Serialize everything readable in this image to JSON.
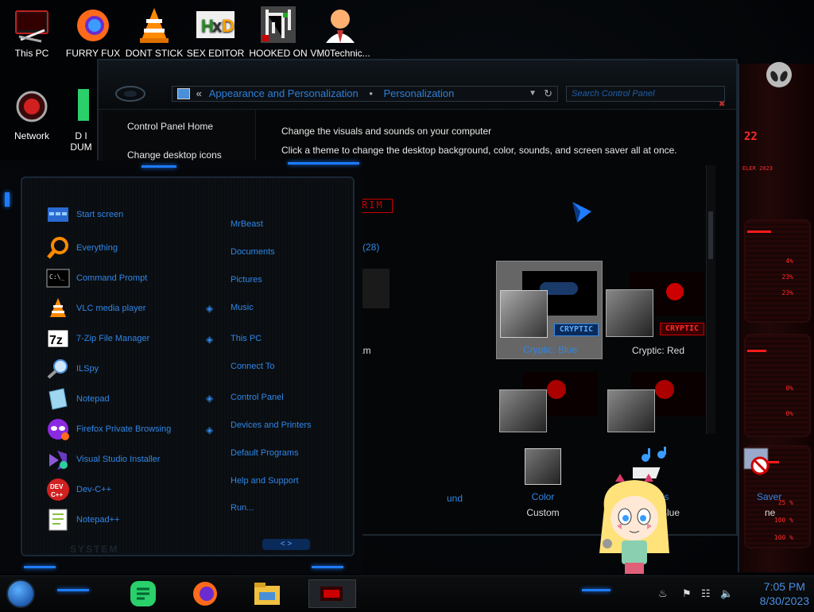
{
  "desktop": {
    "icons": [
      {
        "label": "This PC"
      },
      {
        "label": "FURRY FUX"
      },
      {
        "label": "DONT STICK"
      },
      {
        "label": "SEX EDITOR"
      },
      {
        "label": "HOOKED ON"
      },
      {
        "label": "VM0Technic..."
      },
      {
        "label": "Network"
      },
      {
        "label": "D I DUM"
      }
    ]
  },
  "control_panel": {
    "breadcrumb": {
      "sep": "«",
      "part1": "Appearance and Personalization",
      "dot": "•",
      "part2": "Personalization"
    },
    "search_placeholder": "Search Control Panel",
    "sidebar": {
      "home": "Control Panel Home",
      "desktop_icons": "Change desktop icons"
    },
    "main": {
      "heading": "Change the visuals and sounds on your computer",
      "subheading": "Click a theme to change the desktop background, color, sounds, and screen saver all at once.",
      "count": "(28)",
      "partial_label": "am",
      "themes": [
        {
          "label": "Cryptic: Blue",
          "selected": true,
          "badge": "CRYPTIC"
        },
        {
          "label": "Cryptic: Red",
          "selected": false,
          "badge": "CRYPTIC"
        }
      ],
      "bottom": {
        "background_suffix": "und",
        "color_title": "Color",
        "color_value": "Custom",
        "sounds_title": "Sounds",
        "sounds_value": "Cryptic: Blue",
        "saver_title": "Saver",
        "saver_value": "ne"
      }
    },
    "logo_text": "RIM"
  },
  "start_menu": {
    "apps": [
      {
        "label": "Start screen"
      },
      {
        "label": "Everything"
      },
      {
        "label": "Command Prompt"
      },
      {
        "label": "VLC media player"
      },
      {
        "label": "7-Zip File Manager"
      },
      {
        "label": "ILSpy"
      },
      {
        "label": "Notepad"
      },
      {
        "label": "Firefox Private Browsing"
      },
      {
        "label": "Visual Studio Installer"
      },
      {
        "label": "Dev-C++"
      },
      {
        "label": "Notepad++"
      }
    ],
    "links": [
      {
        "label": "MrBeast"
      },
      {
        "label": "Documents"
      },
      {
        "label": "Pictures"
      },
      {
        "label": "Music"
      },
      {
        "label": "This PC"
      },
      {
        "label": "Connect To"
      },
      {
        "label": "Control Panel"
      },
      {
        "label": "Devices and Printers"
      },
      {
        "label": "Default Programs"
      },
      {
        "label": "Help and Support"
      },
      {
        "label": "Run..."
      }
    ],
    "footer_text": "SYSTEM",
    "nav_arrows": "< >"
  },
  "right_widget": {
    "title_digits": "22",
    "subtitle": "ELER 2023",
    "percents": [
      "4%",
      "23%",
      "23%",
      "0%",
      "0%",
      "25 %",
      "100 %",
      "100 %"
    ]
  },
  "taskbar": {
    "time": "7:05 PM",
    "date": "8/30/2023"
  },
  "colors": {
    "accent_blue": "#2f86e8",
    "accent_red": "#ff2a2a",
    "window_bg": "#0a0c0e"
  }
}
